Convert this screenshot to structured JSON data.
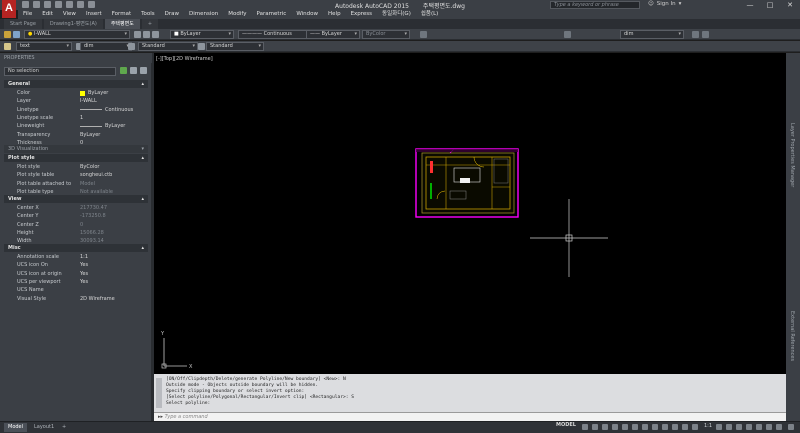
{
  "titlebar": {
    "app_title": "Autodesk AutoCAD 2015",
    "file_title": "주택평면도.dwg",
    "search_placeholder": "Type a keyword or phrase",
    "signin": "Sign In",
    "logo_letter": "A"
  },
  "menu": [
    "File",
    "Edit",
    "View",
    "Insert",
    "Format",
    "Tools",
    "Draw",
    "Dimension",
    "Modify",
    "Parametric",
    "Window",
    "Help",
    "Express",
    "동일화디(G)",
    "쉽품(L)"
  ],
  "file_tabs": [
    {
      "label": "Start Page"
    },
    {
      "label": "Drawing1-평면도(A)"
    },
    {
      "label": "주택평면도"
    }
  ],
  "toolbar1": {
    "layer_value": "I-WALL",
    "color_value": "ByLayer",
    "linetype_value": "Continuous",
    "lineweight_value": "ByLayer",
    "plotstyle_value": "ByColor",
    "right_value": "dim"
  },
  "toolbar2": {
    "textstyle_value": "text",
    "dimstyle_value": "dim",
    "tablestyle_value": "Standard",
    "mleader_value": "Standard"
  },
  "palette": {
    "title": "PROPERTIES",
    "selection": "No selection",
    "sections": {
      "general": "General",
      "viz3d": "3D Visualization",
      "plotstyle": "Plot style",
      "view": "View",
      "misc": "Misc"
    },
    "general_rows": [
      {
        "k": "Color",
        "v": "ByLayer"
      },
      {
        "k": "Layer",
        "v": "I-WALL"
      },
      {
        "k": "Linetype",
        "v": "Continuous"
      },
      {
        "k": "Linetype scale",
        "v": "1"
      },
      {
        "k": "Lineweight",
        "v": "ByLayer"
      },
      {
        "k": "Transparency",
        "v": "ByLayer"
      },
      {
        "k": "Thickness",
        "v": "0"
      }
    ],
    "plot_rows": [
      {
        "k": "Plot style",
        "v": "ByColor"
      },
      {
        "k": "Plot style table",
        "v": "songheui.ctb"
      },
      {
        "k": "Plot table attached to",
        "v": "Model"
      },
      {
        "k": "Plot table type",
        "v": "Not available"
      }
    ],
    "view_rows": [
      {
        "k": "Center X",
        "v": "217730.47"
      },
      {
        "k": "Center Y",
        "v": "-173250.8"
      },
      {
        "k": "Center Z",
        "v": "0"
      },
      {
        "k": "Height",
        "v": "15066.28"
      },
      {
        "k": "Width",
        "v": "30093.14"
      }
    ],
    "misc_rows": [
      {
        "k": "Annotation scale",
        "v": "1:1"
      },
      {
        "k": "UCS icon On",
        "v": "Yes"
      },
      {
        "k": "UCS icon at origin",
        "v": "Yes"
      },
      {
        "k": "UCS per viewport",
        "v": "Yes"
      },
      {
        "k": "UCS Name",
        "v": ""
      },
      {
        "k": "Visual Style",
        "v": "2D Wireframe"
      }
    ],
    "color_accent": "#ffff00"
  },
  "viewport_label": "[-][Top][2D Wireframe]",
  "right_palettes": [
    "Layer Properties Manager",
    "External References"
  ],
  "command": {
    "history": [
      "[ON/Off/Clipdepth/Delete/generate Polyline/New boundary] <New>: N",
      "Outside mode - Objects outside boundary will be hidden.",
      "Specify clipping boundary or select invert option:",
      "[Select polyline/Polygonal/Rectangular/Invert clip] <Rectangular>: S",
      "Select polyline:"
    ],
    "placeholder": "Type a command"
  },
  "status": {
    "tabs": [
      "Model",
      "Layout1"
    ],
    "space": "MODEL",
    "scale": "1:1"
  },
  "colors": {
    "canvas": "#000000",
    "clip_boundary": "#ff00ff",
    "walls": "#c8a000"
  }
}
